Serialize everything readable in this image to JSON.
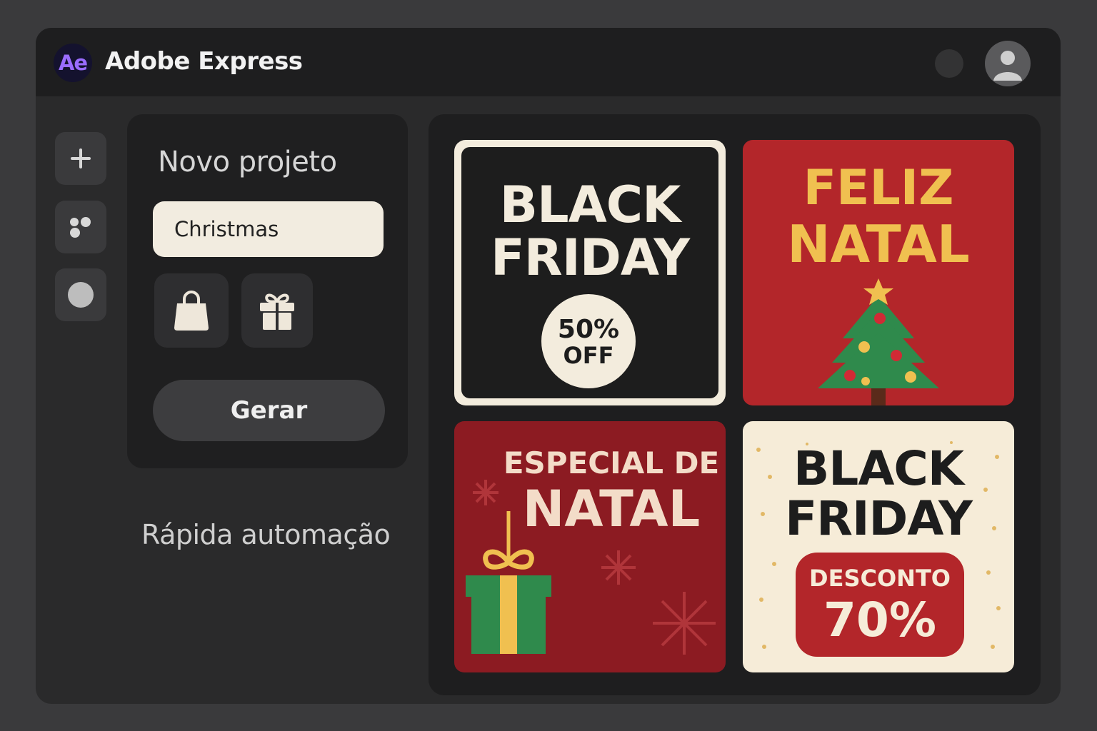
{
  "app": {
    "logo": "Ae",
    "title": "Adobe Express"
  },
  "header": {
    "status_dot_icon": "circle",
    "avatar_icon": "user-avatar-icon"
  },
  "rail": {
    "items": [
      {
        "name": "add",
        "icon": "plus-icon"
      },
      {
        "name": "apps",
        "icon": "dots-cluster-icon"
      },
      {
        "name": "shape",
        "icon": "circle-icon"
      }
    ]
  },
  "panel": {
    "title": "Novo projeto",
    "prompt_value": "Christmas",
    "tools": [
      {
        "icon": "shopping-bag-icon"
      },
      {
        "icon": "gift-icon"
      }
    ],
    "generate_label": "Gerar"
  },
  "tagline": "Rápida automação",
  "templates": {
    "t1": {
      "line1": "BLACK",
      "line2": "FRIDAY",
      "badge_line1": "50%",
      "badge_line2": "OFF"
    },
    "t2": {
      "line1": "FELIZ",
      "line2": "NATAL",
      "illustration": "christmas-tree-icon"
    },
    "t3": {
      "line1": "ESPECIAL DE",
      "line2": "NATAL",
      "illustration": "gift-box-icon"
    },
    "t4": {
      "line1": "BLACK",
      "line2": "FRIDAY",
      "badge_line1": "DESCONTO",
      "badge_line2": "70%"
    }
  },
  "colors": {
    "accent_purple": "#9a6cff",
    "christmas_red": "#b3262a",
    "dark_red": "#8c1b22",
    "gold": "#f0c050",
    "cream": "#f6ecd8",
    "tree_green": "#2f8a4c"
  }
}
